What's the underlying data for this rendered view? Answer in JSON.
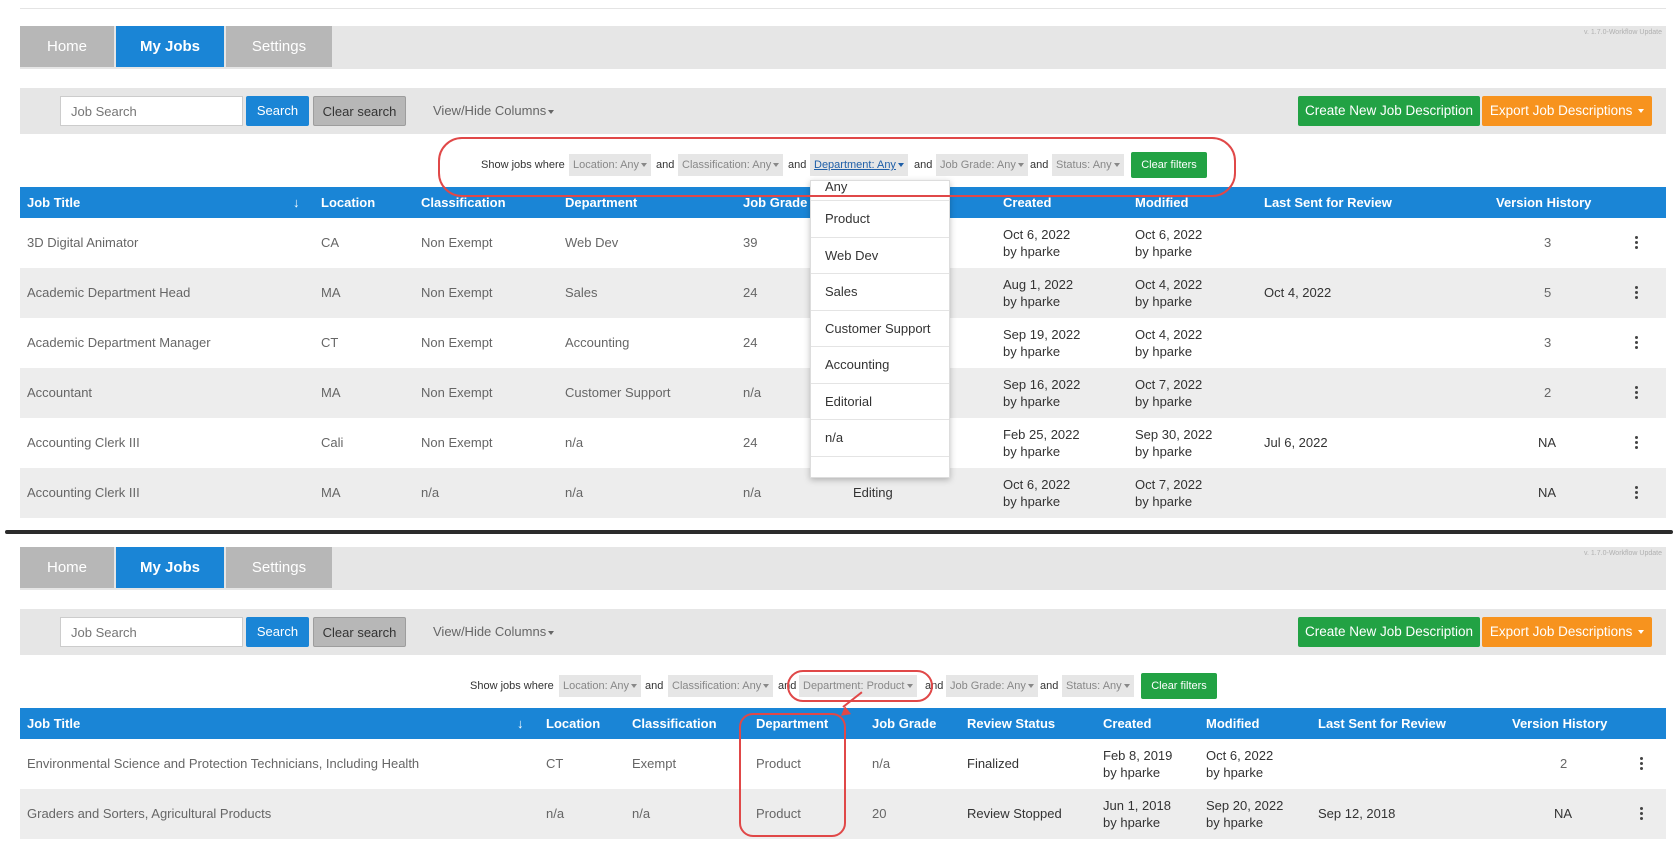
{
  "version": "v. 1.7.0-Workflow Update",
  "nav": {
    "home": "Home",
    "my_jobs": "My Jobs",
    "settings": "Settings"
  },
  "toolbar": {
    "search_placeholder": "Job Search",
    "search_label": "Search",
    "clear_search_label": "Clear search",
    "view_hide_label": "View/Hide Columns",
    "create_label": "Create New Job Description",
    "export_label": "Export Job Descriptions"
  },
  "filters_top": {
    "lead": "Show jobs where",
    "and": "and",
    "location": "Location: Any",
    "classification": "Classification: Any",
    "department": "Department: Any",
    "job_grade": "Job Grade: Any",
    "status": "Status: Any",
    "clear": "Clear filters"
  },
  "filters_bottom": {
    "lead": "Show jobs where",
    "and": "and",
    "location": "Location: Any",
    "classification": "Classification: Any",
    "department": "Department: Product",
    "job_grade": "Job Grade: Any",
    "status": "Status: Any",
    "clear": "Clear filters"
  },
  "department_dropdown": {
    "options": [
      "Any",
      "Product",
      "Web Dev",
      "Sales",
      "Customer Support",
      "Accounting",
      "Editorial",
      "n/a"
    ]
  },
  "table_top": {
    "headers": {
      "job_title": "Job Title",
      "location": "Location",
      "classification": "Classification",
      "department": "Department",
      "job_grade": "Job Grade",
      "created": "Created",
      "modified": "Modified",
      "last_sent": "Last Sent for Review",
      "version_history": "Version History"
    },
    "rows": [
      {
        "title": "3D Digital Animator",
        "location": "CA",
        "classification": "Non Exempt",
        "department": "Web Dev",
        "grade": "39",
        "status": "",
        "created_date": "Oct 6, 2022",
        "created_by": "by hparke",
        "modified_date": "Oct 6, 2022",
        "modified_by": "by hparke",
        "last_sent": "",
        "version": "3"
      },
      {
        "title": "Academic Department Head",
        "location": "MA",
        "classification": "Non Exempt",
        "department": "Sales",
        "grade": "24",
        "status": "",
        "created_date": "Aug 1, 2022",
        "created_by": "by hparke",
        "modified_date": "Oct 4, 2022",
        "modified_by": "by hparke",
        "last_sent": "Oct 4, 2022",
        "version": "5"
      },
      {
        "title": "Academic Department Manager",
        "location": "CT",
        "classification": "Non Exempt",
        "department": "Accounting",
        "grade": "24",
        "status": "",
        "created_date": "Sep 19, 2022",
        "created_by": "by hparke",
        "modified_date": "Oct 4, 2022",
        "modified_by": "by hparke",
        "last_sent": "",
        "version": "3"
      },
      {
        "title": "Accountant",
        "location": "MA",
        "classification": "Non Exempt",
        "department": "Customer Support",
        "grade": "n/a",
        "status": "",
        "created_date": "Sep 16, 2022",
        "created_by": "by hparke",
        "modified_date": "Oct 7, 2022",
        "modified_by": "by hparke",
        "last_sent": "",
        "version": "2"
      },
      {
        "title": "Accounting Clerk III",
        "location": "Cali",
        "classification": "Non Exempt",
        "department": "n/a",
        "grade": "24",
        "status": "",
        "created_date": "Feb 25, 2022",
        "created_by": "by hparke",
        "modified_date": "Sep 30, 2022",
        "modified_by": "by hparke",
        "last_sent": "Jul 6, 2022",
        "version": "NA"
      },
      {
        "title": "Accounting Clerk III",
        "location": "MA",
        "classification": "n/a",
        "department": "n/a",
        "grade": "n/a",
        "status": "Editing",
        "created_date": "Oct 6, 2022",
        "created_by": "by hparke",
        "modified_date": "Oct 7, 2022",
        "modified_by": "by hparke",
        "last_sent": "",
        "version": "NA"
      }
    ]
  },
  "table_bottom": {
    "headers": {
      "job_title": "Job Title",
      "location": "Location",
      "classification": "Classification",
      "department": "Department",
      "job_grade": "Job Grade",
      "review_status": "Review Status",
      "created": "Created",
      "modified": "Modified",
      "last_sent": "Last Sent for Review",
      "version_history": "Version History"
    },
    "rows": [
      {
        "title": "Environmental Science and Protection Technicians, Including Health",
        "location": "CT",
        "classification": "Exempt",
        "department": "Product",
        "grade": "n/a",
        "status": "Finalized",
        "created_date": "Feb 8, 2019",
        "created_by": "by hparke",
        "modified_date": "Oct 6, 2022",
        "modified_by": "by hparke",
        "last_sent": "",
        "version": "2"
      },
      {
        "title": "Graders and Sorters, Agricultural Products",
        "location": "n/a",
        "classification": "n/a",
        "department": "Product",
        "grade": "20",
        "status": "Review Stopped",
        "created_date": "Jun 1, 2018",
        "created_by": "by hparke",
        "modified_date": "Sep 20, 2022",
        "modified_by": "by hparke",
        "last_sent": "Sep 12, 2018",
        "version": "NA"
      }
    ]
  },
  "colors": {
    "primary": "#1a85d6",
    "green": "#22a244",
    "orange": "#f7931e",
    "annotation": "#e04848"
  }
}
